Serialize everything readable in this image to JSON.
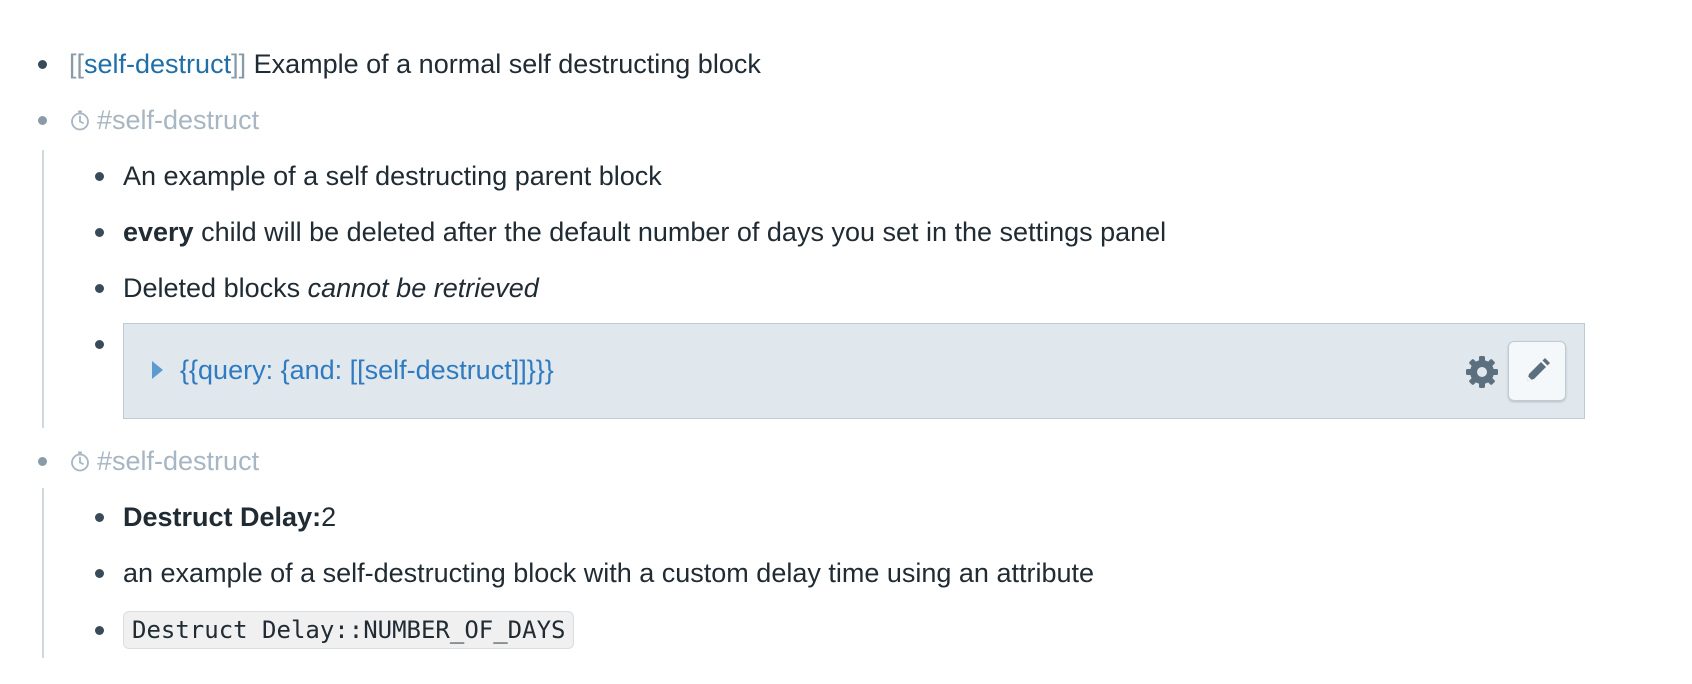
{
  "blocks": {
    "b1": {
      "ref_open": "[[",
      "ref_link": "self-destruct",
      "ref_close": "]]",
      "text": " Example of a normal self destructing block"
    },
    "b2": {
      "icon": "stopwatch-icon",
      "tag": "#self-destruct",
      "children": {
        "c1": {
          "text": "An example of a self destructing parent block"
        },
        "c2": {
          "bold": "every",
          "text": " child will be deleted after the default number of days you set in the settings panel"
        },
        "c3": {
          "text": "Deleted blocks ",
          "italic": "cannot be retrieved"
        },
        "c4": {
          "query": "{{query:  {and: [[self-destruct]]}}}",
          "gear_icon": "gear-icon",
          "edit_icon": "pencil-icon"
        }
      }
    },
    "b3": {
      "icon": "stopwatch-icon",
      "tag": "#self-destruct",
      "children": {
        "c1": {
          "attr_name": "Destruct Delay:",
          "attr_value": "2"
        },
        "c2": {
          "text": "an example of a self-destructing block with a custom delay time using an attribute"
        },
        "c3": {
          "code": "Destruct Delay::NUMBER_OF_DAYS"
        }
      }
    }
  },
  "colors": {
    "link": "#206fa8",
    "bracket": "#8a9ba8",
    "muted_tag": "#a7b6c2",
    "query_text": "#2f7bc1",
    "query_bg": "#e1e8ed"
  }
}
